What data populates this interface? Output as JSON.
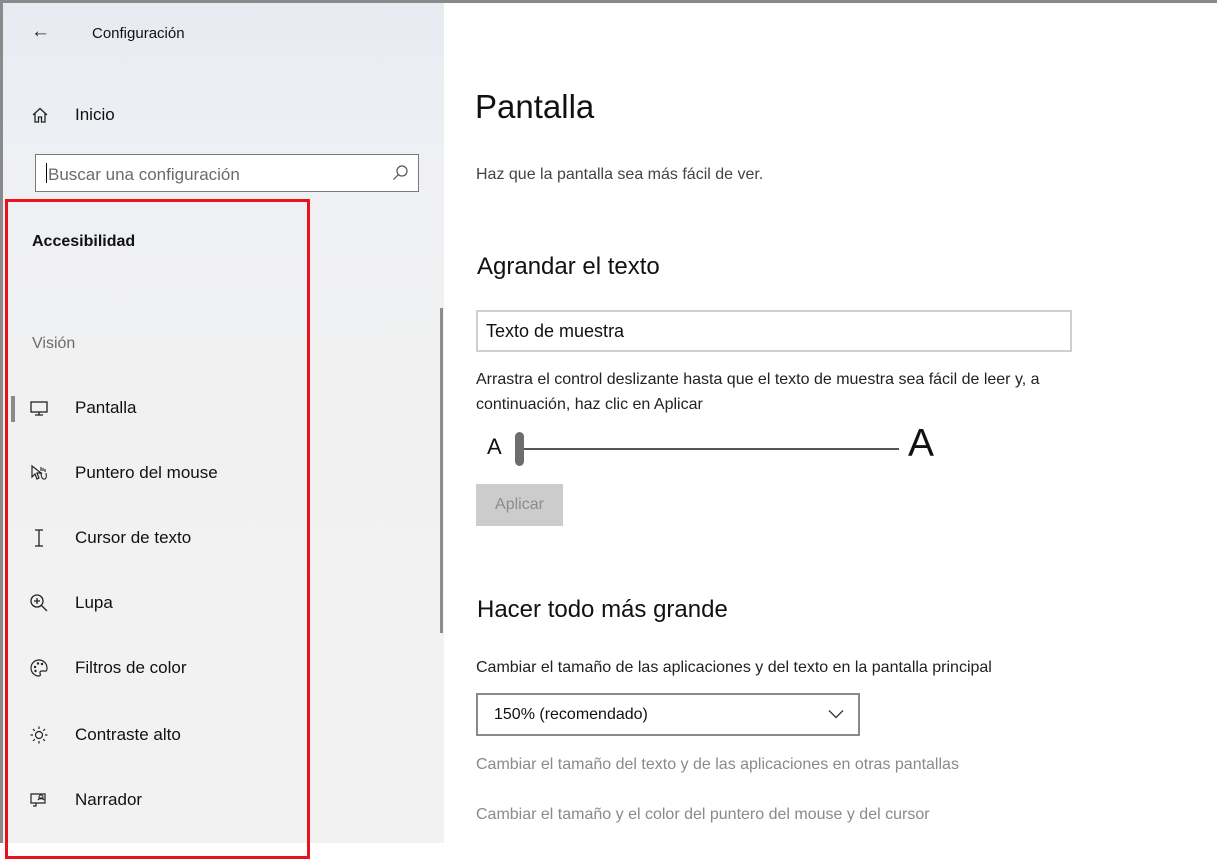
{
  "app": {
    "title": "Configuración"
  },
  "sidebar": {
    "home_label": "Inicio",
    "search_placeholder": "Buscar una configuración",
    "section_title": "Accesibilidad",
    "group_label": "Visión",
    "items": [
      {
        "label": "Pantalla",
        "icon": "monitor-icon",
        "selected": true
      },
      {
        "label": "Puntero del mouse",
        "icon": "pointer-icon",
        "selected": false
      },
      {
        "label": "Cursor de texto",
        "icon": "text-cursor-icon",
        "selected": false
      },
      {
        "label": "Lupa",
        "icon": "magnifier-icon",
        "selected": false
      },
      {
        "label": "Filtros de color",
        "icon": "palette-icon",
        "selected": false
      },
      {
        "label": "Contraste alto",
        "icon": "brightness-icon",
        "selected": false
      },
      {
        "label": "Narrador",
        "icon": "narrator-icon",
        "selected": false
      }
    ]
  },
  "main": {
    "title": "Pantalla",
    "subtitle": "Haz que la pantalla sea más fácil de ver.",
    "text_size": {
      "heading": "Agrandar el texto",
      "sample_text": "Texto de muestra",
      "instructions": "Arrastra el control deslizante hasta que el texto de muestra sea fácil de leer y, a continuación, haz clic en Aplicar",
      "slider_min_label": "A",
      "slider_max_label": "A",
      "slider_value_fraction": 0,
      "apply_label": "Aplicar"
    },
    "scale": {
      "heading": "Hacer todo más grande",
      "label": "Cambiar el tamaño de las aplicaciones y del texto en la pantalla principal",
      "selected_value": "150% (recomendado)",
      "link_other_displays": "Cambiar el tamaño del texto y de las aplicaciones en otras pantallas",
      "link_pointer": "Cambiar el tamaño y el color del puntero del mouse y del cursor"
    }
  },
  "colors": {
    "highlight_border": "#e8131b",
    "sidebar_bg": "#f2f2f2",
    "disabled_button": "#cccccc"
  }
}
